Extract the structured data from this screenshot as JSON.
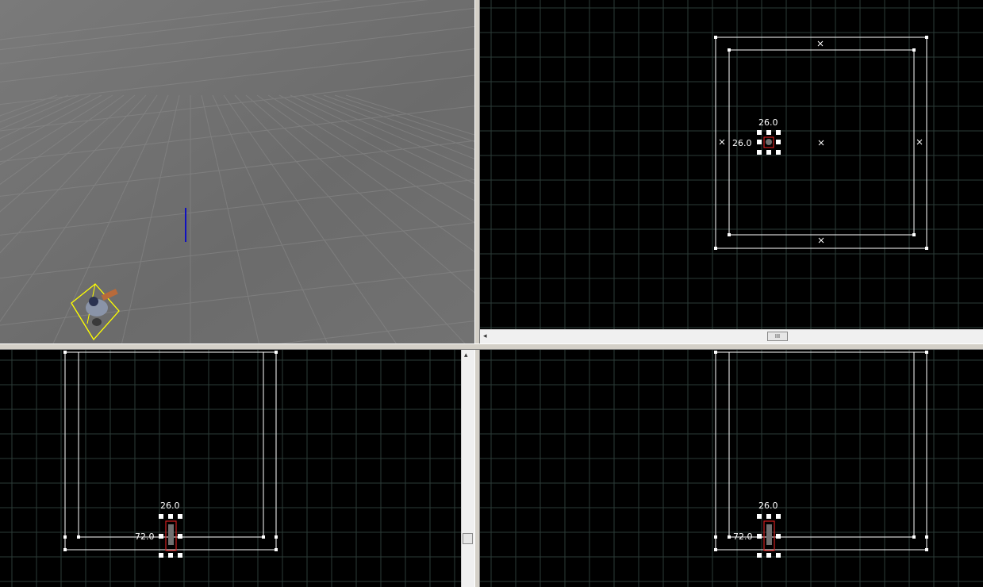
{
  "viewports": {
    "camera_3d": {
      "name": "3d-perspective-viewport"
    },
    "top": {
      "width_label": "26.0",
      "height_label": "26.0"
    },
    "side": {
      "width_label": "26.0",
      "height_label": "72.0"
    },
    "front": {
      "width_label": "26.0",
      "height_label": "72.0"
    }
  },
  "scrollbars": {
    "horizontal_thumb_glyph": "III",
    "left_arrow": "◂",
    "up_arrow": "▴"
  },
  "colors": {
    "grid_minor": "#2c3c38",
    "grid_major": "#3a5a56",
    "brush_outline": "#ffffff",
    "selection": "#ffff00",
    "entity": "#d02020",
    "floor": "#6e6e6e"
  }
}
